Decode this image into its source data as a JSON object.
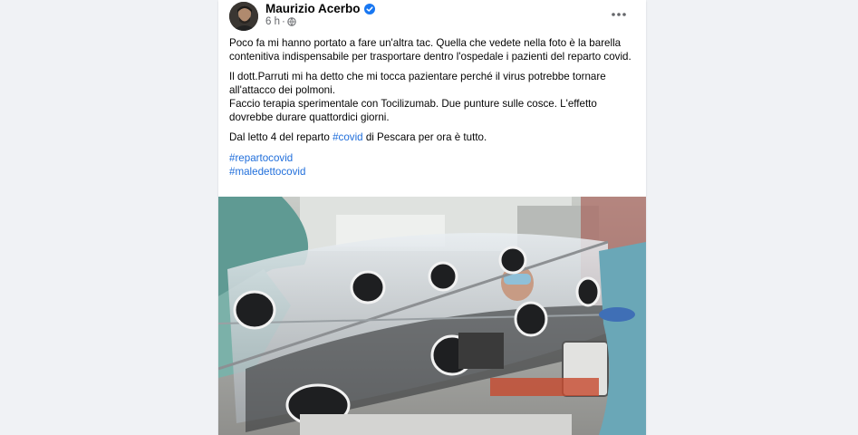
{
  "post": {
    "author": "Maurizio Acerbo",
    "time": "6 h",
    "separator": "·",
    "verified_icon": "verified-badge-icon",
    "privacy_icon": "globe-icon",
    "more_icon": "more-options-icon",
    "paragraphs": {
      "p1": "Poco fa mi hanno portato a fare un'altra tac. Quella che vedete nella foto è la barella contenitiva indispensabile per trasportare dentro l'ospedale i pazienti del reparto covid.",
      "p2_l1": "Il dott.Parruti mi ha detto che  mi tocca pazientare perché il virus potrebbe tornare all'attacco dei polmoni.",
      "p2_l2": "Faccio terapia sperimentale con Tocilizumab. Due punture sulle cosce. L'effetto dovrebbe durare quattordici giorni.",
      "p3_before": "Dal letto 4 del reparto ",
      "p3_tag": "#covid",
      "p3_after": " di Pescara per ora è tutto."
    },
    "hashtags": [
      "#repartocovid",
      "#maledettocovid"
    ],
    "colors": {
      "link": "#216fdb",
      "verified": "#1877f2",
      "meta": "#65676b"
    }
  }
}
